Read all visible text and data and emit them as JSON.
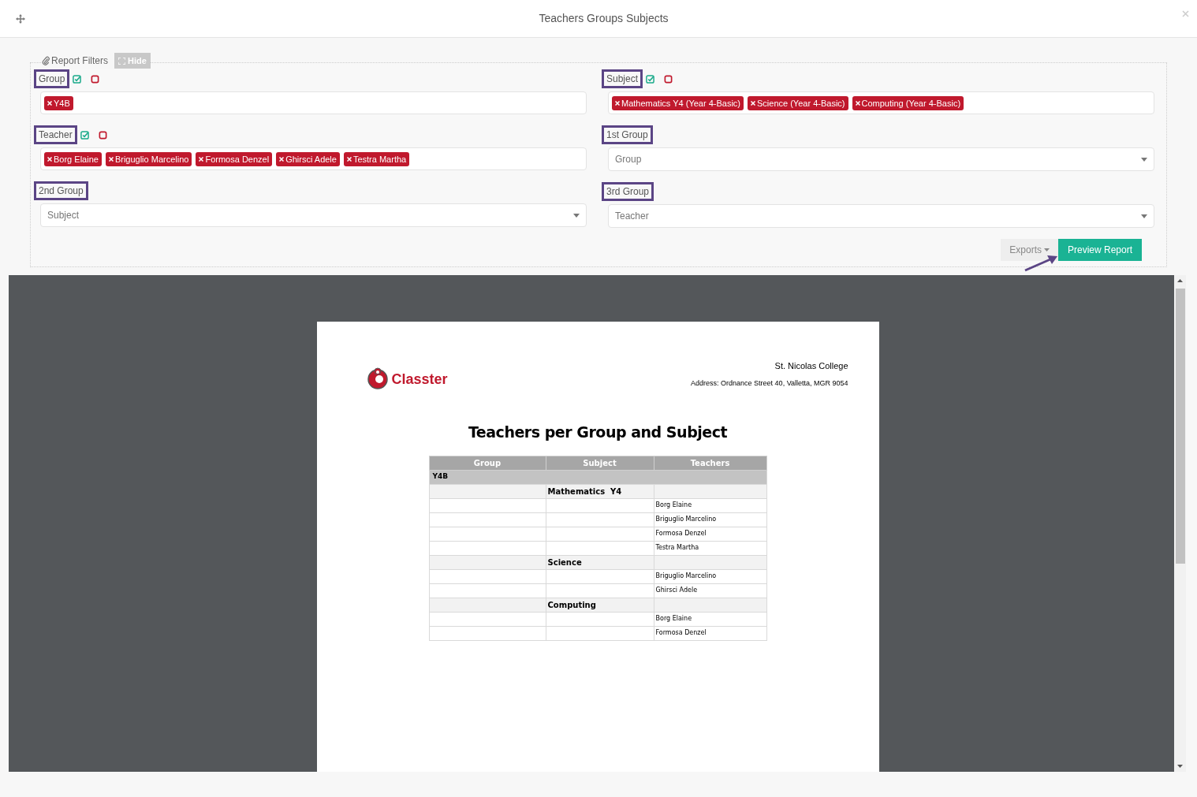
{
  "window": {
    "title": "Teachers Groups Subjects"
  },
  "report_filters": {
    "label": "Report Filters",
    "hide_button": "Hide"
  },
  "filters": [
    {
      "kind": "tags",
      "label": "Group",
      "tags": [
        "Y4B"
      ]
    },
    {
      "kind": "tags",
      "label": "Subject",
      "tags": [
        "Mathematics Y4 (Year 4-Basic)",
        "Science (Year 4-Basic)",
        "Computing (Year 4-Basic)"
      ]
    },
    {
      "kind": "tags",
      "label": "Teacher",
      "tags": [
        "Borg Elaine",
        "Briguglio Marcelino",
        "Formosa Denzel",
        "Ghirsci Adele",
        "Testra Martha"
      ]
    },
    {
      "kind": "select",
      "label": "1st Group",
      "placeholder": "Group"
    },
    {
      "kind": "select",
      "label": "2nd Group",
      "placeholder": "Subject"
    },
    {
      "kind": "select",
      "label": "3rd Group",
      "placeholder": "Teacher"
    }
  ],
  "actions": {
    "exports": "Exports",
    "preview": "Preview Report"
  },
  "report": {
    "logo_text": "Classter",
    "school": "St. Nicolas College",
    "address": "Address: Ordnance Street 40, Valletta, MGR 9054",
    "title": "Teachers per Group and Subject",
    "columns": [
      "Group",
      "Subject",
      "Teachers"
    ],
    "groups": [
      {
        "name": "Y4B",
        "children": [
          {
            "name": "Mathematics  Y4",
            "children": [
              "Borg Elaine",
              "Briguglio Marcelino",
              "Formosa Denzel",
              "Testra Martha"
            ]
          },
          {
            "name": "Science",
            "children": [
              "Briguglio Marcelino",
              "Ghirsci Adele"
            ]
          },
          {
            "name": "Computing",
            "children": [
              "Borg Elaine",
              "Formosa Denzel"
            ]
          }
        ]
      }
    ]
  }
}
